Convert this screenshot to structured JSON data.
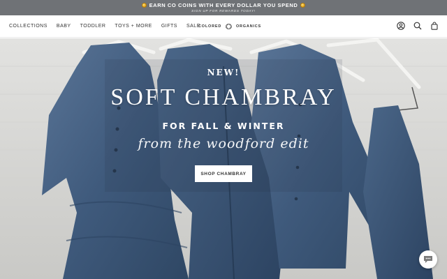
{
  "announcement": {
    "line1": "EARN CO COINS WITH EVERY DOLLAR YOU SPEND",
    "line2": "SIGN UP FOR REWARDS TODAY!"
  },
  "nav": {
    "items": [
      "COLLECTIONS",
      "BABY",
      "TODDLER",
      "TOYS + MORE",
      "GIFTS",
      "SALE"
    ]
  },
  "logo": {
    "left": "COLORED",
    "right": "ORGANICS"
  },
  "header_icons": [
    "account-icon",
    "search-icon",
    "bag-icon"
  ],
  "hero": {
    "eyebrow": "NEW!",
    "title": "SOFT CHAMBRAY",
    "subtitle": "FOR FALL & WINTER",
    "script": "from the woodford edit",
    "cta": "SHOP CHAMBRAY"
  },
  "colors": {
    "announcement_bg": "#6f7276",
    "chambray": "#3d5878",
    "accent": "#ffffff"
  }
}
